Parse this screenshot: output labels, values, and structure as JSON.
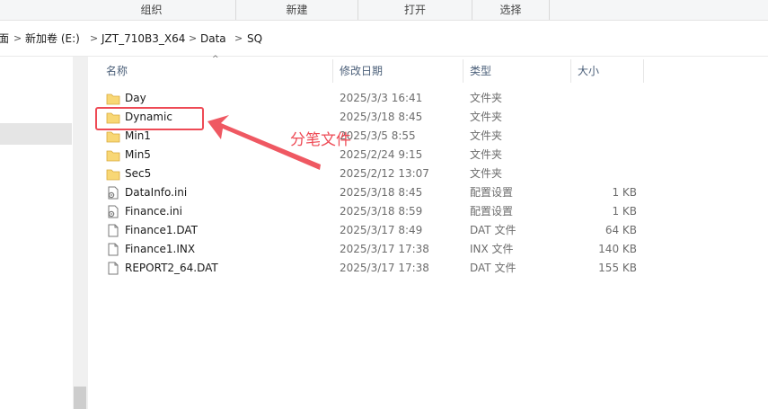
{
  "ribbon": {
    "groups": [
      "组织",
      "新建",
      "打开",
      "选择"
    ]
  },
  "address": {
    "crumbs": [
      "面",
      "新加卷 (E:)",
      "JZT_710B3_X64",
      "Data",
      "SQ"
    ],
    "separator": ">"
  },
  "columns": {
    "name": "名称",
    "date": "修改日期",
    "type": "类型",
    "size": "大小"
  },
  "files": [
    {
      "name": "Day",
      "date": "2025/3/3 16:41",
      "type": "文件夹",
      "size": "",
      "icon": "folder-icon"
    },
    {
      "name": "Dynamic",
      "date": "2025/3/18 8:45",
      "type": "文件夹",
      "size": "",
      "icon": "folder-icon"
    },
    {
      "name": "Min1",
      "date": "2025/3/5 8:55",
      "type": "文件夹",
      "size": "",
      "icon": "folder-icon"
    },
    {
      "name": "Min5",
      "date": "2025/2/24 9:15",
      "type": "文件夹",
      "size": "",
      "icon": "folder-icon"
    },
    {
      "name": "Sec5",
      "date": "2025/2/12 13:07",
      "type": "文件夹",
      "size": "",
      "icon": "folder-icon"
    },
    {
      "name": "DataInfo.ini",
      "date": "2025/3/18 8:45",
      "type": "配置设置",
      "size": "1 KB",
      "icon": "settings-file-icon"
    },
    {
      "name": "Finance.ini",
      "date": "2025/3/18 8:59",
      "type": "配置设置",
      "size": "1 KB",
      "icon": "settings-file-icon"
    },
    {
      "name": "Finance1.DAT",
      "date": "2025/3/17 8:49",
      "type": "DAT 文件",
      "size": "64 KB",
      "icon": "file-icon"
    },
    {
      "name": "Finance1.INX",
      "date": "2025/3/17 17:38",
      "type": "INX 文件",
      "size": "140 KB",
      "icon": "file-icon"
    },
    {
      "name": "REPORT2_64.DAT",
      "date": "2025/3/17 17:38",
      "type": "DAT 文件",
      "size": "155 KB",
      "icon": "file-icon"
    }
  ],
  "annotation": {
    "text": "分笔文件",
    "highlighted": "Dynamic",
    "color": "#ee4a55"
  },
  "colors": {
    "folder": "#f8d775",
    "header_text": "#4c607a",
    "accent": "#ee4a55"
  }
}
